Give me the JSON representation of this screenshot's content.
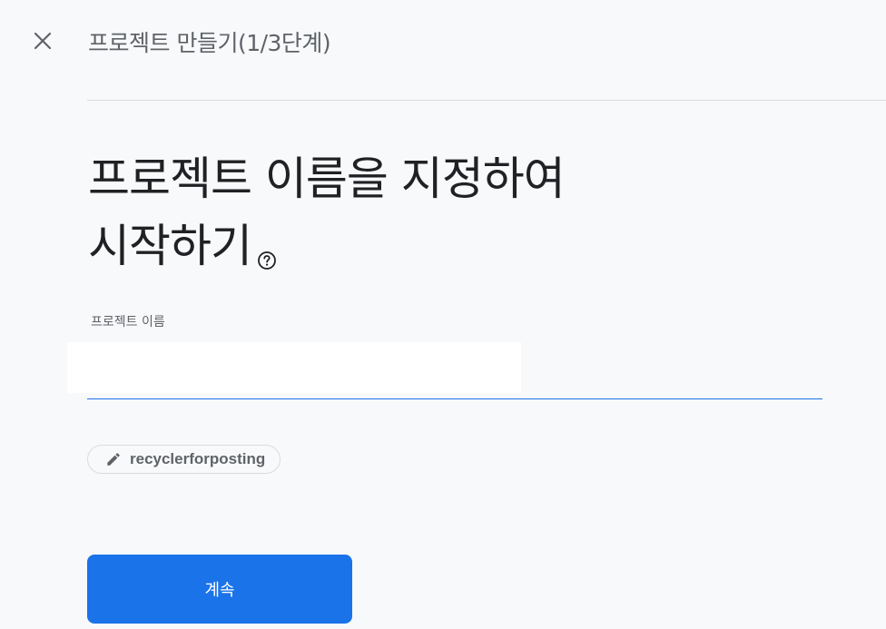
{
  "header": {
    "title": "프로젝트 만들기(1/3단계)",
    "close_icon": "close-icon"
  },
  "main": {
    "title": "프로젝트 이름을 지정하여 시작하기",
    "help_icon": "help-circle-icon"
  },
  "form": {
    "project_name_label": "프로젝트 이름",
    "project_name_value": "",
    "project_id_icon": "pencil-icon",
    "project_id": "recyclerforposting"
  },
  "actions": {
    "continue_label": "계속"
  },
  "colors": {
    "accent": "#1a73e8",
    "background": "#f8f9fa",
    "text_primary": "#202124",
    "text_secondary": "#5f6368"
  }
}
